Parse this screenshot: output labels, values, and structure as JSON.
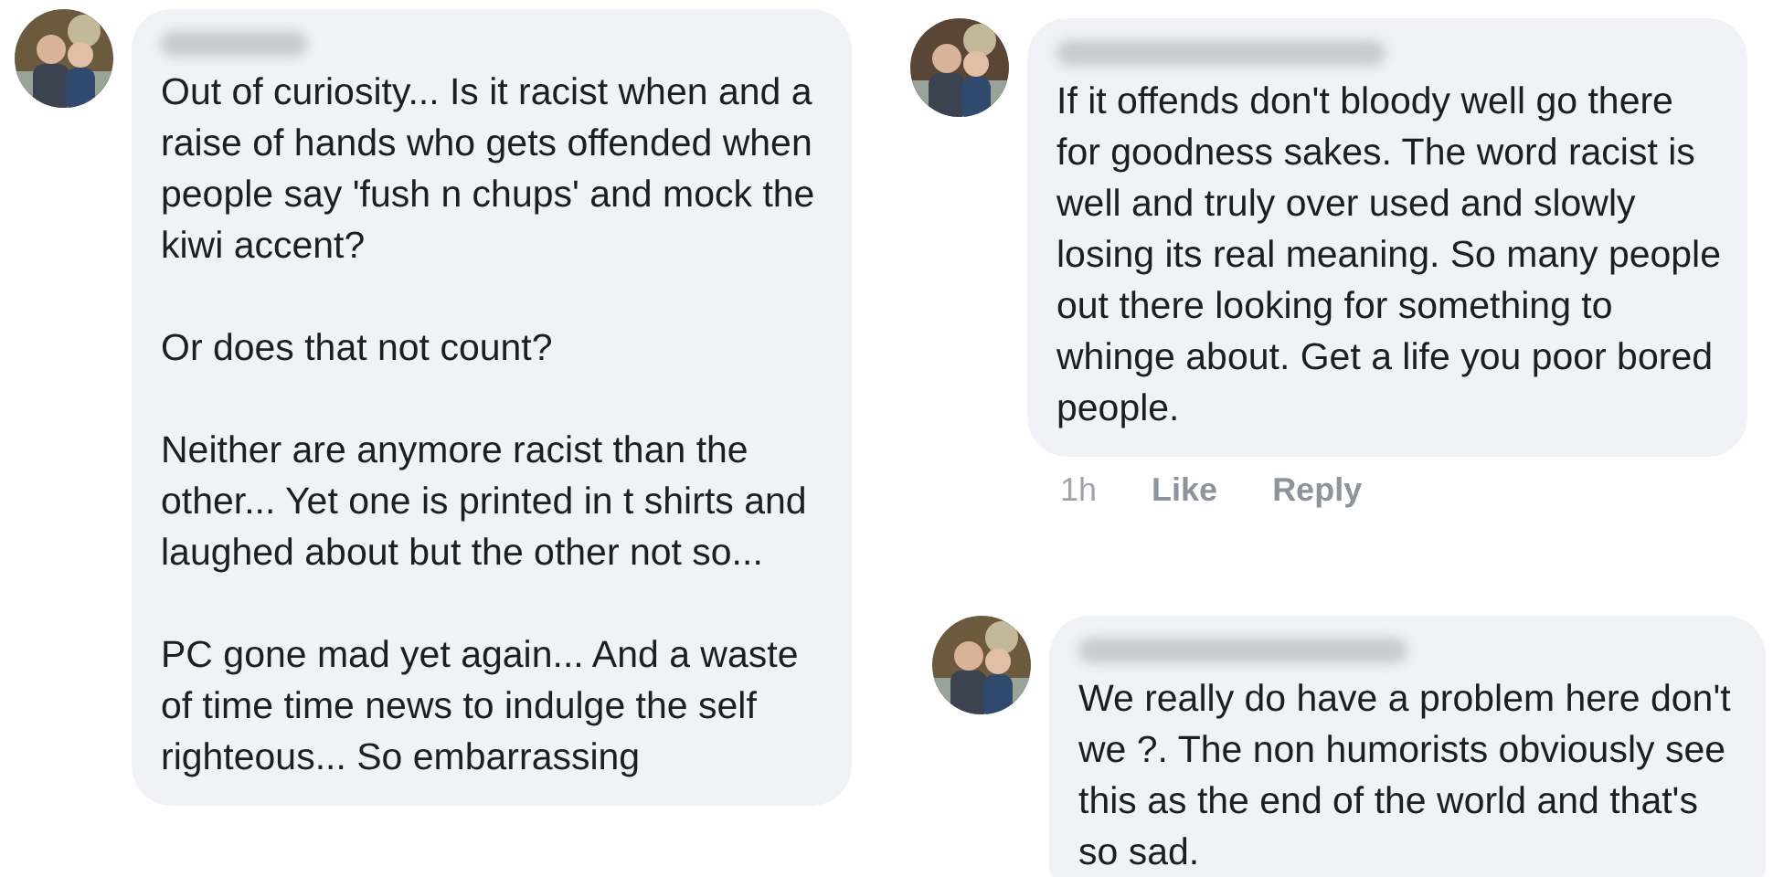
{
  "columns": [
    {
      "comments": [
        {
          "paragraphs": [
            "Out of curiosity... Is it racist when and a raise of hands who gets offended when people say 'fush n chups' and mock the kiwi accent?",
            "Or does that not count?",
            "Neither are anymore racist than the other... Yet one is printed in t shirts and laughed about but the other not so...",
            "PC gone mad yet again... And a waste of time time news to indulge the self righteous... So embarrassing"
          ]
        }
      ]
    },
    {
      "comments": [
        {
          "paragraphs": [
            "If it offends don't bloody well go there for goodness sakes. The word racist is well and truly over used and slowly losing its real meaning. So many people out there looking for something to whinge about. Get a life you poor bored people."
          ],
          "actions": {
            "time": "1h",
            "like": "Like",
            "reply": "Reply"
          }
        },
        {
          "paragraphs": [
            "We really do have a problem here don't we ?. The non humorists obviously see this as the end of the world and that's so sad."
          ]
        }
      ]
    }
  ]
}
